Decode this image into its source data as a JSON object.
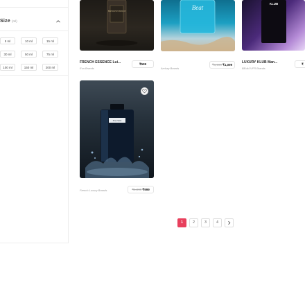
{
  "filter": {
    "title": "Size",
    "unit": "(ml)",
    "sizes": [
      "5 ml",
      "10 ml",
      "15 ml",
      "30 ml",
      "50 ml",
      "75 ml",
      "100 ml",
      "150 ml",
      "200 ml"
    ]
  },
  "products": [
    {
      "name": "FRENCH ESSENCE Lui...",
      "brand": "Eva Brands",
      "price": "₹599",
      "image_text": "FRENCH ESSENCE"
    },
    {
      "name": "",
      "brand": "Archay Brands",
      "price_original": "₹1,599",
      "price": "₹1,099",
      "image_text": "Beat"
    },
    {
      "name": "LUXURY KLUB Man...",
      "brand": "BEoM VFR Brands",
      "price": "₹",
      "image_text": "KLUB"
    },
    {
      "name": "",
      "brand": "French Luxury Brands",
      "price_original": "₹1,999",
      "price": "₹999",
      "image_text": "Yves Saint"
    }
  ],
  "pagination": {
    "pages": [
      "1",
      "2",
      "3",
      "4"
    ],
    "current": "1",
    "next_icon": "chevron-right-icon",
    "accent_color": "#e8405d"
  }
}
